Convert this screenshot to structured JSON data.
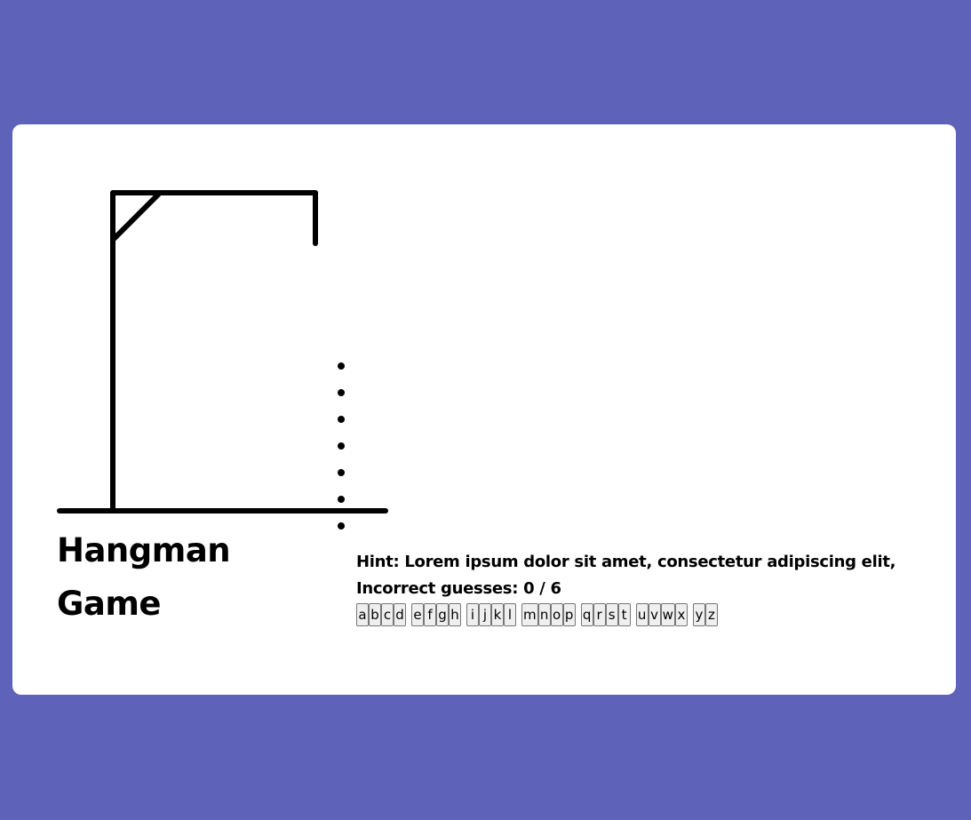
{
  "title_line1": "Hangman",
  "title_line2": "Game",
  "hint_label": "Hint:",
  "hint_text": "Lorem ipsum dolor sit amet, consectetur adipiscing elit,",
  "guesses_label": "Incorrect guesses:",
  "incorrect_guesses": "0 / 6",
  "word_letter_count": 7,
  "keyboard_keys": [
    "a",
    "b",
    "c",
    "d",
    "e",
    "f",
    "g",
    "h",
    "i",
    "j",
    "k",
    "l",
    "m",
    "n",
    "o",
    "p",
    "q",
    "r",
    "s",
    "t",
    "u",
    "v",
    "w",
    "x",
    "y",
    "z"
  ],
  "colors": {
    "background": "#5e63b9",
    "card": "#ffffff",
    "key_background": "#efefef",
    "key_border": "#767676"
  }
}
